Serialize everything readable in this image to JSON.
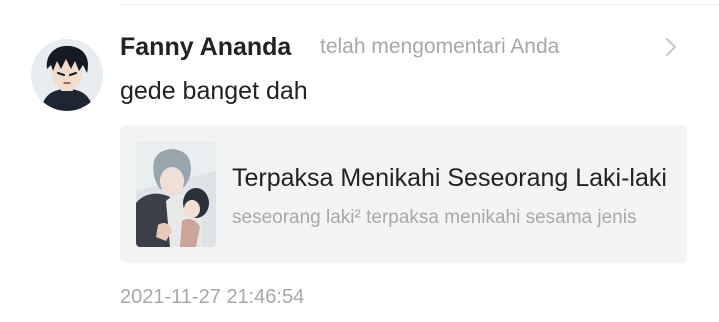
{
  "notification": {
    "user_name": "Fanny Ananda",
    "action_text": "telah mengomentari Anda",
    "comment": "gede banget dah",
    "timestamp": "2021-11-27 21:46:54",
    "chevron_icon": "chevron-right-icon",
    "avatar_icon": "user-avatar"
  },
  "card": {
    "title": "Terpaksa Menikahi Seseorang Laki-laki",
    "description": "seseorang laki² terpaksa menikahi sesama jenis",
    "thumbnail_icon": "comic-cover-thumbnail"
  },
  "colors": {
    "primary_text": "#222222",
    "secondary_text": "#a8a8a8",
    "card_background": "#f4f4f4"
  }
}
